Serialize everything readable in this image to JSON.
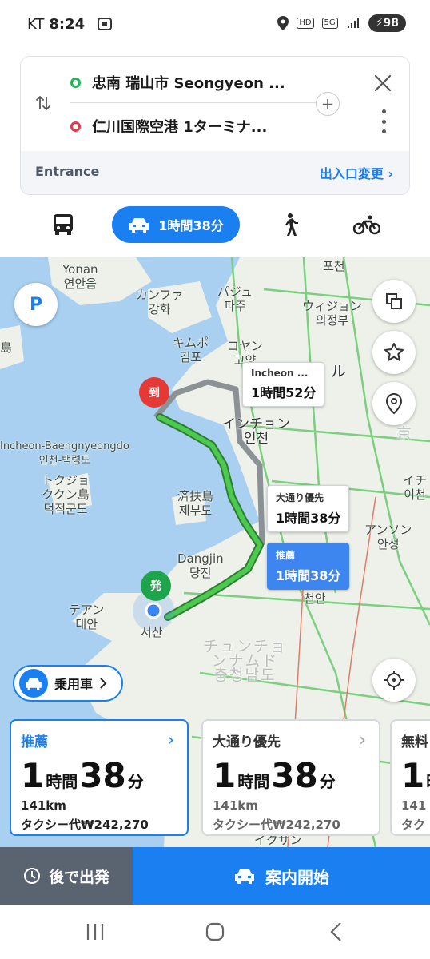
{
  "status_bar": {
    "carrier": "KT",
    "time": "8:24",
    "battery": "98"
  },
  "route": {
    "origin": "忠南 瑞山市 Seongyeon ...",
    "destination": "仁川国際空港 1ターミナ...",
    "entrance_label": "Entrance",
    "entrance_change": "出入口変更 ›"
  },
  "tabs": {
    "car_time": "1時間38分"
  },
  "map": {
    "labels": [
      {
        "text": "Yonan\n연안읍",
        "name": "map-label-yonan"
      },
      {
        "text": "カンファ\n강화",
        "name": "map-label-ganghwa"
      },
      {
        "text": "パジュ\n파주",
        "name": "map-label-paju"
      },
      {
        "text": "포천",
        "name": "map-label-pocheon"
      },
      {
        "text": "ウィジョン\n의정부",
        "name": "map-label-uijeongbu"
      },
      {
        "text": "キムポ\n김포",
        "name": "map-label-gimpo"
      },
      {
        "text": "コヤン\n고양",
        "name": "map-label-goyang"
      },
      {
        "text": "インチョン\n인천",
        "name": "map-label-incheon"
      },
      {
        "text": "Incheon-Baengnyeongdo\n인천-백령도",
        "name": "map-label-baengnyeongdo"
      },
      {
        "text": "トクジョ\nククン島\n덕적군도",
        "name": "map-label-deokjeok"
      },
      {
        "text": "済扶島\n제부도",
        "name": "map-label-jebudo"
      },
      {
        "text": "イチ\n이천",
        "name": "map-label-icheon"
      },
      {
        "text": "アンソン\n안성",
        "name": "map-label-anseong"
      },
      {
        "text": "Dangjin\n당진",
        "name": "map-label-dangjin"
      },
      {
        "text": "천안",
        "name": "map-label-cheonan"
      },
      {
        "text": "テアン\n태안",
        "name": "map-label-taean"
      },
      {
        "text": "서산",
        "name": "map-label-seosan"
      },
      {
        "text": "チュンチョ\nンナムド\n충청남도",
        "name": "map-label-chungnam"
      },
      {
        "text": "島",
        "name": "map-label-island"
      },
      {
        "text": "ル",
        "name": "map-label-seoul-partial"
      },
      {
        "text": "京",
        "name": "map-label-gyeong-partial"
      },
      {
        "text": "イクサン",
        "name": "map-label-iksan"
      }
    ],
    "bubbles": {
      "alt1_sub": "Incheon ...",
      "alt1_time": "1時間52分",
      "alt2_sub": "大通り優先",
      "alt2_time": "1時間38分",
      "rec_sub": "推薦",
      "rec_time": "1時間38分"
    },
    "marker_dest": "到",
    "marker_origin": "発",
    "vehicle_chip": "乗用車"
  },
  "route_options": [
    {
      "title": "推薦",
      "hours": "1",
      "hours_unit": "時間",
      "minutes": "38",
      "minutes_unit": "分",
      "distance": "141km",
      "fare": "タクシー代₩242,270"
    },
    {
      "title": "大通り優先",
      "hours": "1",
      "hours_unit": "時間",
      "minutes": "38",
      "minutes_unit": "分",
      "distance": "141km",
      "fare": "タクシー代₩242,270"
    },
    {
      "title": "無料",
      "hours": "1",
      "hours_unit": "時",
      "minutes": "",
      "minutes_unit": "",
      "distance": "141",
      "fare": "タク"
    }
  ],
  "bottom": {
    "later_label": "後で出発",
    "start_label": "案内開始"
  },
  "colors": {
    "accent": "#1a7ff0",
    "route_green": "#2eab3c",
    "route_gray": "#8c9196",
    "dest_red": "#e53935",
    "origin_green": "#1ea54c"
  }
}
